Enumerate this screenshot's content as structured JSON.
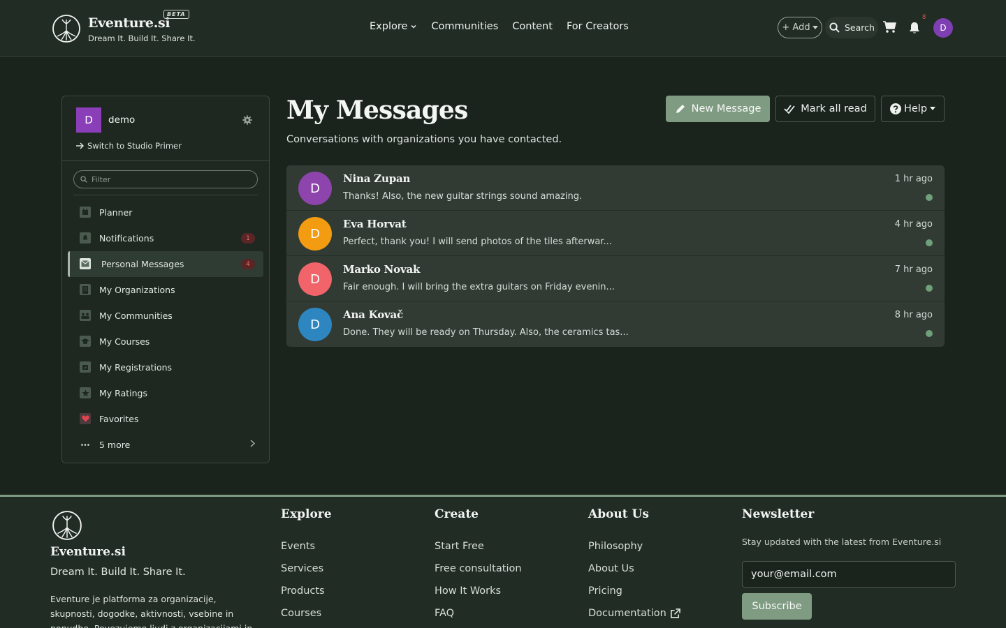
{
  "header": {
    "brand": "Eventure.si",
    "beta": "BETA",
    "tagline": "Dream It. Build It. Share It.",
    "nav": [
      "Explore",
      "Communities",
      "Content",
      "For Creators"
    ],
    "add_label": "+ Add",
    "search_label": "Search",
    "notification_count": "8",
    "avatar_initial": "D"
  },
  "sidebar": {
    "user_initial": "D",
    "user_name": "demo",
    "switch_label": "Switch to Studio Primer",
    "filter_placeholder": "Filter",
    "items": [
      {
        "label": "Planner",
        "icon": "calendar-icon"
      },
      {
        "label": "Notifications",
        "icon": "bell-icon",
        "count": "1"
      },
      {
        "label": "Personal Messages",
        "icon": "envelope-icon",
        "count": "4",
        "active": true
      },
      {
        "label": "My Organizations",
        "icon": "building-icon"
      },
      {
        "label": "My Communities",
        "icon": "users-icon"
      },
      {
        "label": "My Courses",
        "icon": "graduation-cap-icon"
      },
      {
        "label": "My Registrations",
        "icon": "calendar-check-icon"
      },
      {
        "label": "My Ratings",
        "icon": "star-icon"
      },
      {
        "label": "Favorites",
        "icon": "heart-icon"
      },
      {
        "label": "5 more",
        "icon": "ellipsis-icon"
      }
    ]
  },
  "main": {
    "title": "My Messages",
    "subtitle": "Conversations with organizations you have contacted.",
    "new_message": "New Message",
    "mark_all_read": "Mark all read",
    "help": "Help"
  },
  "messages": [
    {
      "initial": "D",
      "name": "Nina Zupan",
      "preview": "Thanks! Also, the new guitar strings sound amazing.",
      "time": "1 hr ago",
      "color": "#8e44ad"
    },
    {
      "initial": "D",
      "name": "Eva Horvat",
      "preview": "Perfect, thank you! I will send photos of the tiles afterwar...",
      "time": "4 hr ago",
      "color": "#f39c12"
    },
    {
      "initial": "D",
      "name": "Marko Novak",
      "preview": "Fair enough. I will bring the extra guitars on Friday evenin...",
      "time": "7 hr ago",
      "color": "#f0646a"
    },
    {
      "initial": "D",
      "name": "Ana Kovač",
      "preview": "Done. They will be ready on Thursday. Also, the ceramics tas...",
      "time": "8 hr ago",
      "color": "#2e86c1"
    }
  ],
  "footer": {
    "brand": "Eventure.si",
    "tagline": "Dream It. Build It. Share It.",
    "description": "Eventure je platforma za organizacije, skupnosti, dogodke, aktivnosti, vsebine in ponudbe. Povezujemo ljudi z organizacijami in",
    "explore": {
      "title": "Explore",
      "links": [
        "Events",
        "Services",
        "Products",
        "Courses"
      ]
    },
    "create": {
      "title": "Create",
      "links": [
        "Start Free",
        "Free consultation",
        "How It Works",
        "FAQ"
      ]
    },
    "about": {
      "title": "About Us",
      "links": [
        "Philosophy",
        "About Us",
        "Pricing",
        "Documentation"
      ]
    },
    "newsletter": {
      "title": "Newsletter",
      "text": "Stay updated with the latest from Eventure.si",
      "email_value": "your@email.com",
      "subscribe": "Subscribe"
    }
  }
}
